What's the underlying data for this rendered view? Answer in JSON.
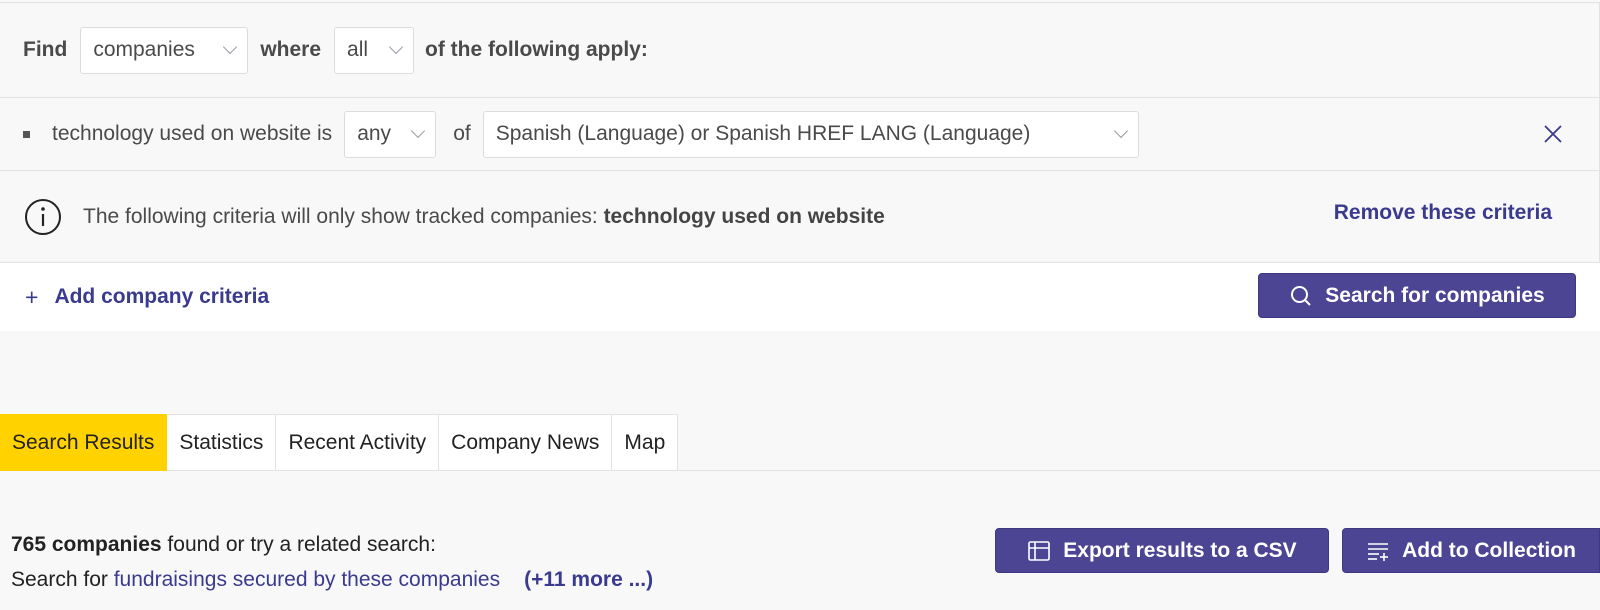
{
  "query": {
    "find_label": "Find",
    "entity_select": "companies",
    "where_label": "where",
    "match_select": "all",
    "tail_label": "of the following apply:"
  },
  "criterion": {
    "field_text": "technology used on website is",
    "quantifier_select": "any",
    "of_label": "of",
    "value_select": "Spanish (Language) or Spanish HREF LANG (Language)"
  },
  "notice": {
    "text": "The following criteria will only show tracked companies:",
    "bold_text": "technology used on website",
    "remove_link": "Remove these criteria"
  },
  "actions": {
    "add_criteria": "Add company criteria",
    "search_button": "Search for companies"
  },
  "tabs": [
    {
      "label": "Search Results",
      "active": true
    },
    {
      "label": "Statistics",
      "active": false
    },
    {
      "label": "Recent Activity",
      "active": false
    },
    {
      "label": "Company News",
      "active": false
    },
    {
      "label": "Map",
      "active": false
    }
  ],
  "results": {
    "count_text": "765 companies",
    "found_text": " found or try a related search:",
    "search_for": "Search for ",
    "related_link": "fundraisings secured by these companies",
    "more_link": "(+11 more ...)",
    "export_button": "Export results to a CSV",
    "collection_button": "Add to Collection"
  },
  "colors": {
    "accent": "#4b4593",
    "link": "#3a3a8e",
    "active_tab": "#ffd200"
  },
  "icons": [
    "close-icon",
    "info-icon",
    "plus-icon",
    "search-icon",
    "table-icon",
    "list-add-icon",
    "chevron-down-icon"
  ]
}
